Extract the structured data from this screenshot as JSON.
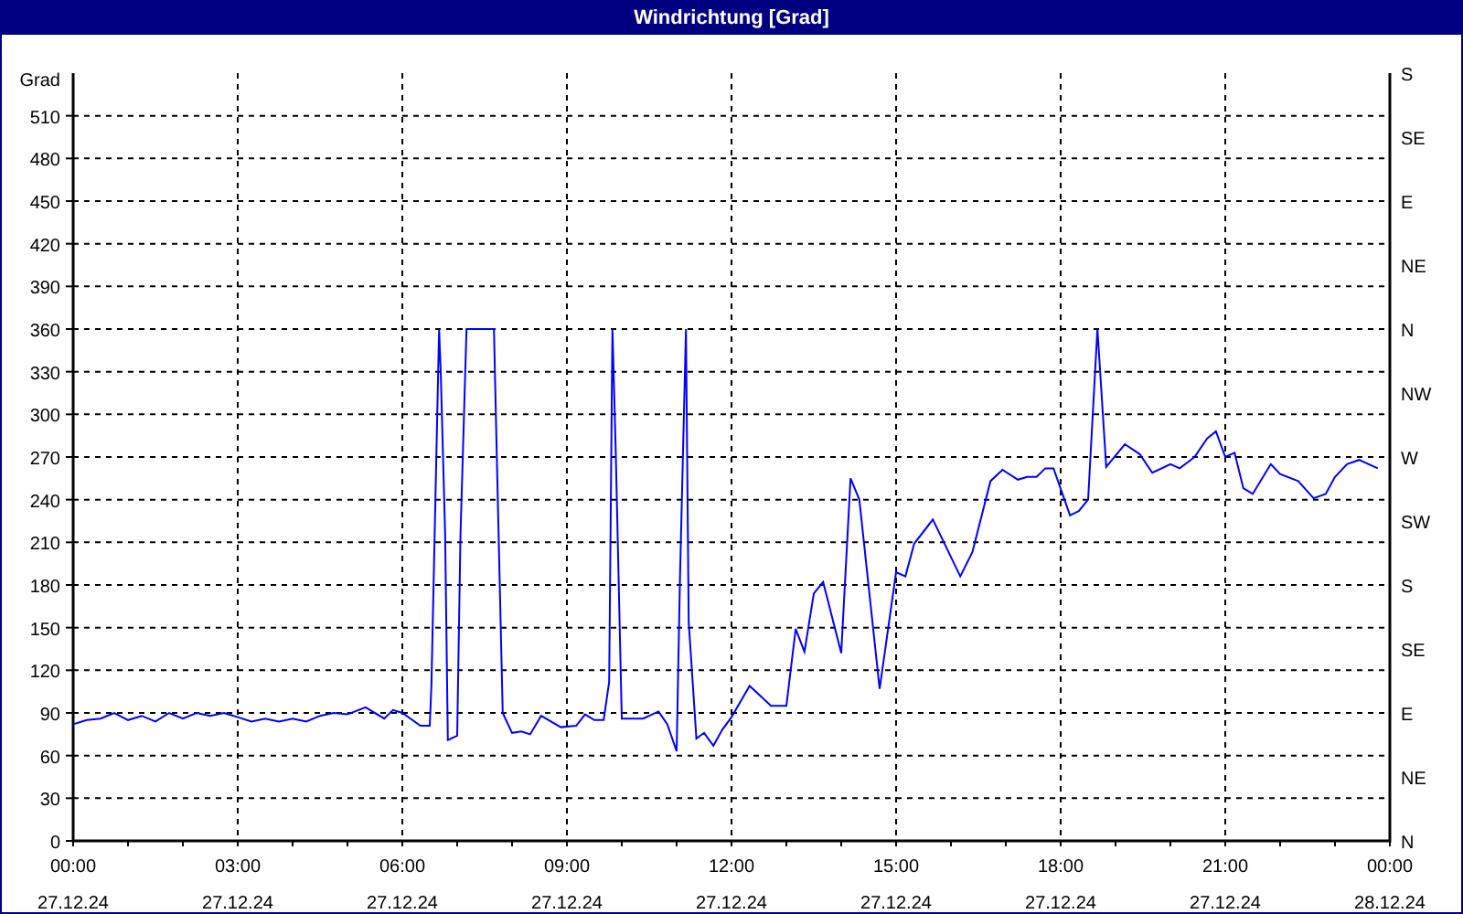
{
  "window": {
    "title": "Windrichtung [Grad]"
  },
  "chart": {
    "chart_data": {
      "type": "line",
      "ylabel": "Grad",
      "x": [
        0,
        0.25,
        0.5,
        0.75,
        1,
        1.25,
        1.5,
        1.75,
        2,
        2.25,
        2.5,
        2.75,
        3,
        3.25,
        3.5,
        3.75,
        4,
        4.25,
        4.5,
        4.75,
        5,
        5.33,
        5.67,
        5.83,
        6,
        6.33,
        6.5,
        6.53,
        6.67,
        6.7,
        6.78,
        6.83,
        7,
        7.06,
        7.17,
        7.67,
        7.72,
        7.83,
        8,
        8.17,
        8.33,
        8.53,
        8.89,
        9.17,
        9.33,
        9.5,
        9.67,
        9.77,
        9.83,
        9.89,
        10,
        10.39,
        10.67,
        10.83,
        11,
        11.06,
        11.17,
        11.22,
        11.36,
        11.5,
        11.67,
        11.83,
        12,
        12.33,
        12.72,
        13,
        13.17,
        13.33,
        13.5,
        13.67,
        14,
        14.17,
        14.33,
        14.7,
        15,
        15.17,
        15.33,
        15.67,
        16.17,
        16.39,
        16.72,
        16.94,
        17.22,
        17.39,
        17.56,
        17.72,
        17.87,
        18.17,
        18.33,
        18.5,
        18.67,
        18.83,
        19.17,
        19.44,
        19.67,
        20,
        20.17,
        20.44,
        20.67,
        20.83,
        21,
        21.17,
        21.33,
        21.5,
        21.83,
        22,
        22.33,
        22.61,
        22.83,
        23,
        23.22,
        23.44,
        23.78
      ],
      "series": [
        {
          "color": "#0000ff",
          "values": [
            82,
            85,
            86,
            90,
            85,
            88,
            84,
            90,
            86,
            90,
            88,
            90,
            87,
            84,
            86,
            84,
            86,
            84,
            88,
            90,
            89,
            94,
            86,
            92,
            90,
            81,
            81,
            109,
            360,
            330,
            216,
            71,
            74,
            215,
            360,
            360,
            274,
            90,
            76,
            77,
            75,
            88,
            80,
            81,
            89,
            85,
            85,
            112,
            360,
            274,
            86,
            86,
            91,
            82,
            63,
            183,
            360,
            154,
            72,
            76,
            67,
            78,
            87,
            109,
            95,
            95,
            149,
            133,
            174,
            182,
            132,
            255,
            240,
            107,
            189,
            186,
            209,
            226,
            186,
            203,
            253,
            261,
            254,
            256,
            256,
            262,
            262,
            229,
            232,
            240,
            360,
            263,
            279,
            272,
            259,
            265,
            262,
            270,
            283,
            288,
            270,
            273,
            248,
            244,
            265,
            258,
            253,
            241,
            244,
            256,
            265,
            268,
            262
          ]
        }
      ],
      "xlim": [
        0,
        24
      ],
      "ylim": [
        0,
        540
      ],
      "xticks": [
        {
          "value": 0,
          "label": "00:00"
        },
        {
          "value": 3,
          "label": "03:00"
        },
        {
          "value": 6,
          "label": "06:00"
        },
        {
          "value": 9,
          "label": "09:00"
        },
        {
          "value": 12,
          "label": "12:00"
        },
        {
          "value": 15,
          "label": "15:00"
        },
        {
          "value": 18,
          "label": "18:00"
        },
        {
          "value": 21,
          "label": "21:00"
        },
        {
          "value": 24,
          "label": "00:00"
        }
      ],
      "yticks": [
        0,
        30,
        60,
        90,
        120,
        150,
        180,
        210,
        240,
        270,
        300,
        330,
        360,
        390,
        420,
        450,
        480,
        510
      ],
      "grid": true
    },
    "tick_dates": [
      "27.12.24",
      "27.12.24",
      "27.12.24",
      "27.12.24",
      "27.12.24",
      "27.12.24",
      "27.12.24",
      "27.12.24",
      "28.12.24"
    ],
    "compass_labels": [
      "S",
      "SE",
      "E",
      "NE",
      "N",
      "NW",
      "W",
      "SW",
      "S",
      "SE",
      "E",
      "NE",
      "N"
    ]
  }
}
